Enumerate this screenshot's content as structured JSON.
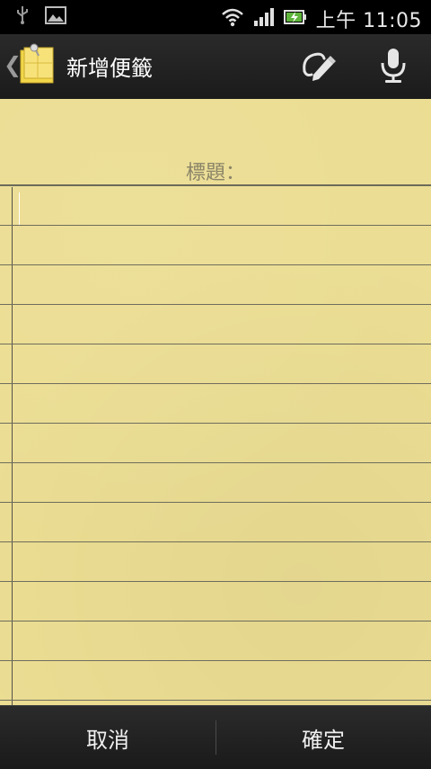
{
  "status_bar": {
    "time": "上午 11:05",
    "icons": [
      "usb-icon",
      "image-icon",
      "wifi-icon",
      "signal-icon",
      "battery-charging-icon"
    ]
  },
  "action_bar": {
    "title": "新增便籤",
    "back_icon": "chevron-left-icon",
    "app_icon": "sticky-note-icon",
    "actions": [
      "ink-pen-icon",
      "microphone-icon"
    ]
  },
  "note": {
    "title_label": "標題：",
    "body_value": ""
  },
  "buttons": {
    "cancel": "取消",
    "confirm": "確定"
  },
  "colors": {
    "paper": "#ebdd92",
    "rule": "#6f6d5e",
    "bar": "#1f1f1f"
  }
}
